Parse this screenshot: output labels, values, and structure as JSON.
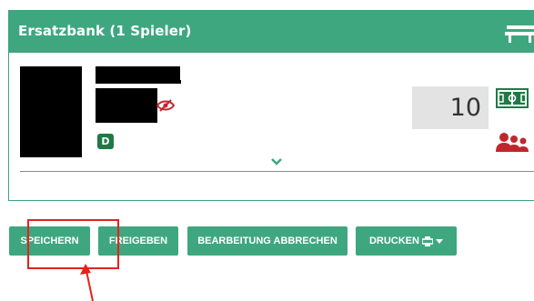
{
  "panel": {
    "title": "Ersatzbank (1 Spieler)",
    "player": {
      "position_badge": "D",
      "number_value": "10"
    }
  },
  "icons": {
    "bench": "bench-icon",
    "hidden": "eye-slash-icon",
    "field": "soccer-field-icon",
    "group": "users-icon",
    "expand": "chevron-down-icon",
    "print": "printer-icon",
    "dropdown": "caret-down-icon"
  },
  "buttons": {
    "save": "SPEICHERN",
    "release": "FREIGEBEN",
    "cancel": "BEARBEITUNG ABBRECHEN",
    "print": "DRUCKEN"
  },
  "colors": {
    "accent": "#3ea77f",
    "badge": "#1f7a46",
    "warning": "#c0272d",
    "annotation": "#e5221b"
  }
}
